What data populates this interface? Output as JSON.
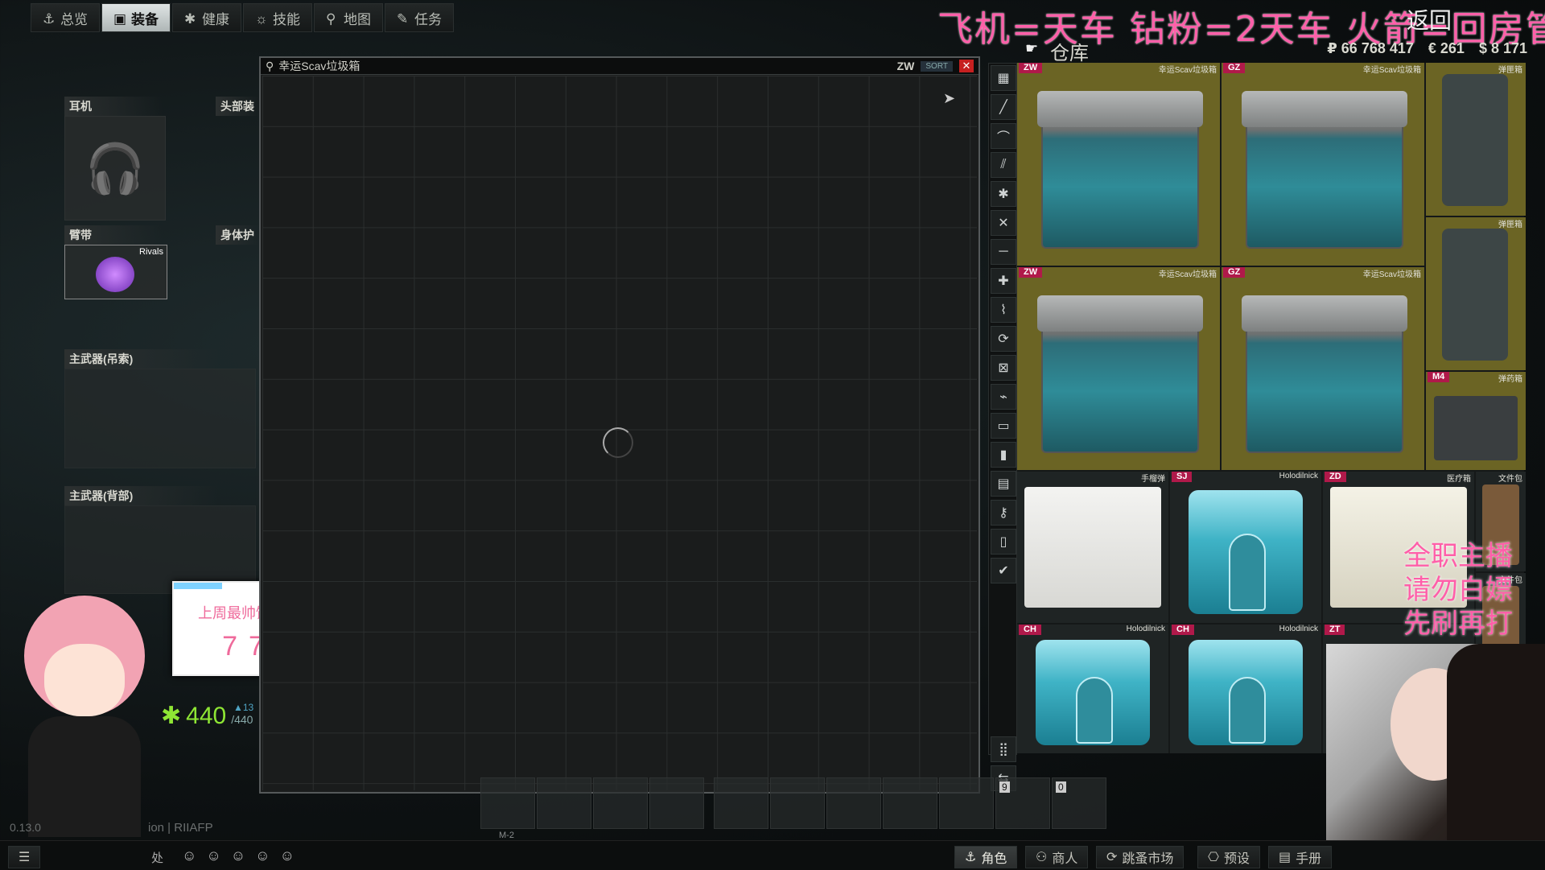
{
  "nav": {
    "tabs": [
      {
        "label": "总览",
        "icon": "anchor-icon"
      },
      {
        "label": "装备",
        "icon": "vest-icon"
      },
      {
        "label": "健康",
        "icon": "medical-icon"
      },
      {
        "label": "技能",
        "icon": "skills-icon"
      },
      {
        "label": "地图",
        "icon": "map-pin-icon"
      },
      {
        "label": "任务",
        "icon": "tasks-icon"
      }
    ]
  },
  "overlay": {
    "stream_title": "飞机=天车 钻粉=2天车 火箭=回房管",
    "back_hint": "返回",
    "watermark": "全职主播\n请勿白嫖\n先刷再打",
    "card_title": "上周最帅饲养员",
    "card_value": "77"
  },
  "stash": {
    "label": "仓库",
    "currency": {
      "rub": "₽ 66 768 417",
      "eur": "€ 261",
      "usd": "$ 8 171"
    },
    "items": [
      {
        "tag": "ZW",
        "name": "幸运Scav垃圾箱"
      },
      {
        "tag": "GZ",
        "name": "幸运Scav垃圾箱"
      },
      {
        "tag": "",
        "name": "弹匣箱"
      },
      {
        "tag": "",
        "name": "弹匣箱"
      },
      {
        "tag": "ZW",
        "name": "幸运Scav垃圾箱"
      },
      {
        "tag": "GZ",
        "name": "幸运Scav垃圾箱"
      },
      {
        "tag": "M4",
        "name": "弹药箱"
      },
      {
        "tag": "",
        "name": "手榴弹"
      },
      {
        "tag": "SJ",
        "name": "Holodilnick"
      },
      {
        "tag": "ZD",
        "name": "医疗箱"
      },
      {
        "tag": "",
        "name": "文件包"
      },
      {
        "tag": "",
        "name": "文件包"
      },
      {
        "tag": "CH",
        "name": "Holodilnick"
      },
      {
        "tag": "CH",
        "name": "Holodilnick"
      },
      {
        "tag": "ZT",
        "name": ""
      }
    ]
  },
  "container_window": {
    "title": "幸运Scav垃圾箱",
    "code": "ZW",
    "sort_label": "SORT",
    "close_label": "✕"
  },
  "equipment": {
    "earpiece": "耳机",
    "headwear": "头部装",
    "armband": "臂带",
    "armband_item": "Rivals",
    "body_armor": "身体护",
    "primary_sling": "主武器(吊索)",
    "primary_back": "主武器(背部)"
  },
  "player": {
    "health_current": "440",
    "health_max": "/440",
    "health_delta": "▲13",
    "version_left": "0.13.0",
    "version_right": "ion | RIIAFP"
  },
  "fast_slots": {
    "slot9": "9",
    "slot0": "0",
    "magazine_label": "M-2"
  },
  "bottom": {
    "handbook_prefix": "处",
    "buttons": [
      {
        "label": "角色",
        "icon": "character-icon"
      },
      {
        "label": "商人",
        "icon": "traders-icon"
      },
      {
        "label": "跳蚤市场",
        "icon": "flea-market-icon"
      },
      {
        "label": "预设",
        "icon": "presets-icon"
      },
      {
        "label": "手册",
        "icon": "handbook-icon"
      }
    ]
  }
}
